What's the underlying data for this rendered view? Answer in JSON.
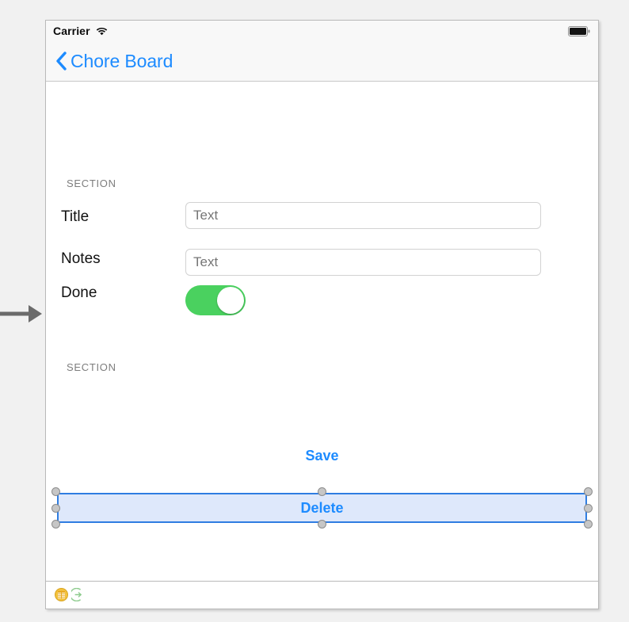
{
  "canvas": {
    "annotation_arrow": "right-arrow-annotation"
  },
  "status_bar": {
    "carrier_label": "Carrier",
    "wifi_icon": "wifi-icon",
    "battery_icon": "battery-full-icon"
  },
  "nav_bar": {
    "back_icon": "chevron-left-icon",
    "back_title": "Chore Board"
  },
  "form": {
    "sections": [
      {
        "header": "SECTION"
      },
      {
        "header": "SECTION"
      }
    ],
    "rows": [
      {
        "label": "Title",
        "value": "",
        "placeholder": "Text",
        "type": "textfield"
      },
      {
        "label": "Notes",
        "value": "",
        "placeholder": "Text",
        "type": "textfield"
      },
      {
        "label": "Done",
        "type": "switch",
        "state": "on",
        "on_color": "#4AD15F"
      }
    ],
    "save_button": "Save",
    "delete_button": "Delete",
    "selection": {
      "selected_element": "Delete",
      "border_color": "#2F7DE1",
      "fill_color": "#DEE8FB",
      "handle_color": "#C6C6C6",
      "handle_count": 8
    }
  },
  "dock_bar": {
    "icons": [
      {
        "name": "view-controller-icon",
        "color": "#F0B429"
      },
      {
        "name": "exit-segue-icon",
        "color": "#7EC87E"
      }
    ]
  },
  "colors": {
    "tint_blue": "#1D8BFF",
    "switch_green": "#4AD15F",
    "page_background": "#F1F1F1",
    "chrome_background": "#F8F8F8"
  }
}
